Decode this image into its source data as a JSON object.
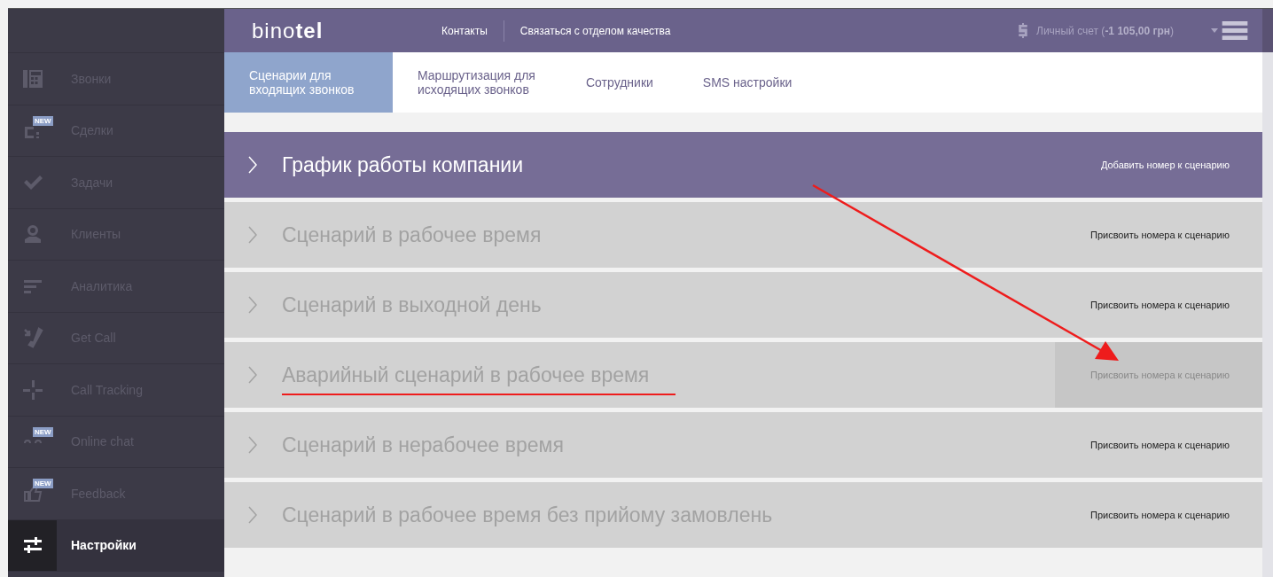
{
  "logo": {
    "text": "bino",
    "bold": "tel"
  },
  "top_links": [
    "Контакты",
    "Связаться с отделом качества"
  ],
  "account": {
    "label": "Личный счет (",
    "amount": "-1 105,00 грн",
    "close": ")"
  },
  "sidebar": {
    "items": [
      {
        "label": "Звонки",
        "selected": false
      },
      {
        "label": "Сделки",
        "badge": "NEW",
        "selected": false
      },
      {
        "label": "Задачи",
        "selected": false
      },
      {
        "label": "Клиенты",
        "selected": false
      },
      {
        "label": "Аналитика",
        "selected": false
      },
      {
        "label": "Get Call",
        "selected": false
      },
      {
        "label": "Call Tracking",
        "selected": false
      },
      {
        "label": "Online chat",
        "badge": "NEW",
        "selected": false
      },
      {
        "label": "Feedback",
        "badge": "NEW",
        "selected": false
      },
      {
        "label": "Настройки",
        "selected": true
      }
    ]
  },
  "tabs": [
    {
      "label": "Сценарии для входящих звонков",
      "selected": true
    },
    {
      "label": "Маршрутизация для исходящих звонков",
      "selected": false
    },
    {
      "label": "Сотрудники",
      "selected": false
    },
    {
      "label": "SMS настройки",
      "selected": false
    }
  ],
  "scenarios": [
    {
      "title": "График работы компании",
      "action": "Добавить номер к сценарию",
      "selected": true,
      "hover": false,
      "annotated": false
    },
    {
      "title": "Сценарий в рабочее время",
      "action": "Присвоить номера к сценарию",
      "selected": false,
      "hover": false,
      "annotated": false
    },
    {
      "title": "Сценарий в выходной день",
      "action": "Присвоить номера к сценарию",
      "selected": false,
      "hover": false,
      "annotated": false
    },
    {
      "title": "Аварийный сценарий в рабочее время",
      "action": "Присвоить номера к сценарию",
      "selected": false,
      "hover": true,
      "annotated": true
    },
    {
      "title": "Сценарий в нерабочее время",
      "action": "Присвоить номера к сценарию",
      "selected": false,
      "hover": false,
      "annotated": false
    },
    {
      "title": "Сценарий в рабочее время без прийому замовлень",
      "action": "Присвоить номера к сценарию",
      "selected": false,
      "hover": false,
      "annotated": false
    }
  ]
}
